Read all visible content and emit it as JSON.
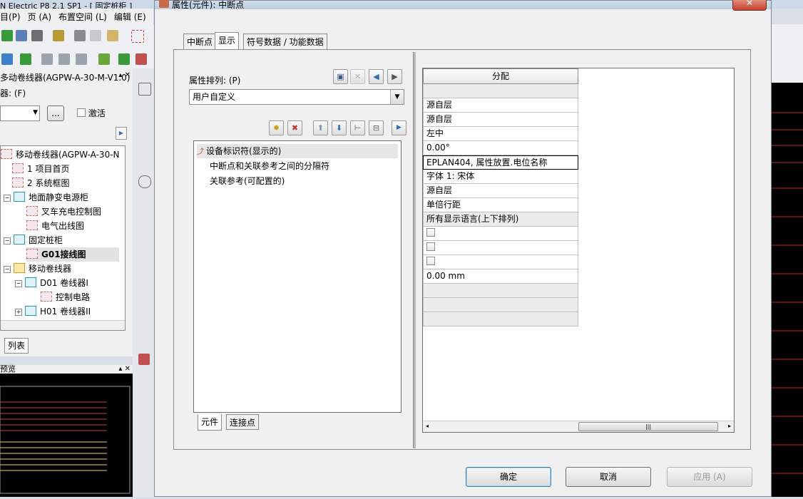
{
  "background_app": {
    "title": "N Electric P8 2.1 SP1 - [ 固定桩柜 ]",
    "menu": [
      "目(P)",
      "页 (A)",
      "布置空间 (L)",
      "编辑 (E)"
    ],
    "navigator": {
      "title": "多动卷线器(AGPW-A-30-M-V1.0)",
      "filter_label": "器: (F)",
      "activate_label": "激活",
      "more_button": "...",
      "tree": [
        {
          "label": "移动卷线器(AGPW-A-30-N",
          "icon": "project"
        },
        {
          "label": "1 项目首页",
          "icon": "page"
        },
        {
          "label": "2 系统框图",
          "icon": "page"
        },
        {
          "label": "地面静变电源柜",
          "icon": "cabinet"
        },
        {
          "label": "叉车充电控制图",
          "icon": "page"
        },
        {
          "label": "电气出线图",
          "icon": "page"
        },
        {
          "label": "固定桩柜",
          "icon": "cabinet"
        },
        {
          "label": "G01接线图",
          "icon": "page"
        },
        {
          "label": "移动卷线器",
          "icon": "location"
        },
        {
          "label": "D01 卷线器I",
          "icon": "cabinet"
        },
        {
          "label": "控制电路",
          "icon": "page"
        },
        {
          "label": "H01 卷线器II",
          "icon": "cabinet"
        }
      ],
      "tab_label": "列表"
    },
    "preview_label": "预览"
  },
  "dialog": {
    "title": "属性(元件): 中断点",
    "close_label": "✕",
    "tabs": [
      "中断点",
      "显示",
      "符号数据 / 功能数据"
    ],
    "sort_label": "属性排列: (P)",
    "sort_value": "用户自定义",
    "list_items": [
      "设备标识符(显示的)",
      "中断点和关联参考之间的分隔符",
      "关联参考(可配置的)"
    ],
    "bottom_tabs": [
      "元件",
      "连接点"
    ],
    "grid_header": "分配",
    "grid_rows": [
      {
        "value": "",
        "type": "gray"
      },
      {
        "value": "源自层",
        "type": "text"
      },
      {
        "value": "源自层",
        "type": "text"
      },
      {
        "value": "左中",
        "type": "text"
      },
      {
        "value": "0.00°",
        "type": "text"
      },
      {
        "value": "EPLAN404, 属性放置.电位名称",
        "type": "selected"
      },
      {
        "value": "字体 1: 宋体",
        "type": "text"
      },
      {
        "value": "源自层",
        "type": "text"
      },
      {
        "value": "单倍行距",
        "type": "text"
      },
      {
        "value": "所有显示语言(上下排列)",
        "type": "gray"
      },
      {
        "value": "",
        "type": "checkbox"
      },
      {
        "value": "",
        "type": "checkbox"
      },
      {
        "value": "",
        "type": "checkbox"
      },
      {
        "value": "0.00 mm",
        "type": "text"
      },
      {
        "value": "",
        "type": "gray"
      },
      {
        "value": "",
        "type": "gray"
      },
      {
        "value": "",
        "type": "gray"
      }
    ],
    "ok_label": "确定",
    "cancel_label": "取消",
    "apply_label": "应用 (A)"
  },
  "colors": {
    "accent": "#2a6ebb",
    "selected_border": "#000000"
  }
}
